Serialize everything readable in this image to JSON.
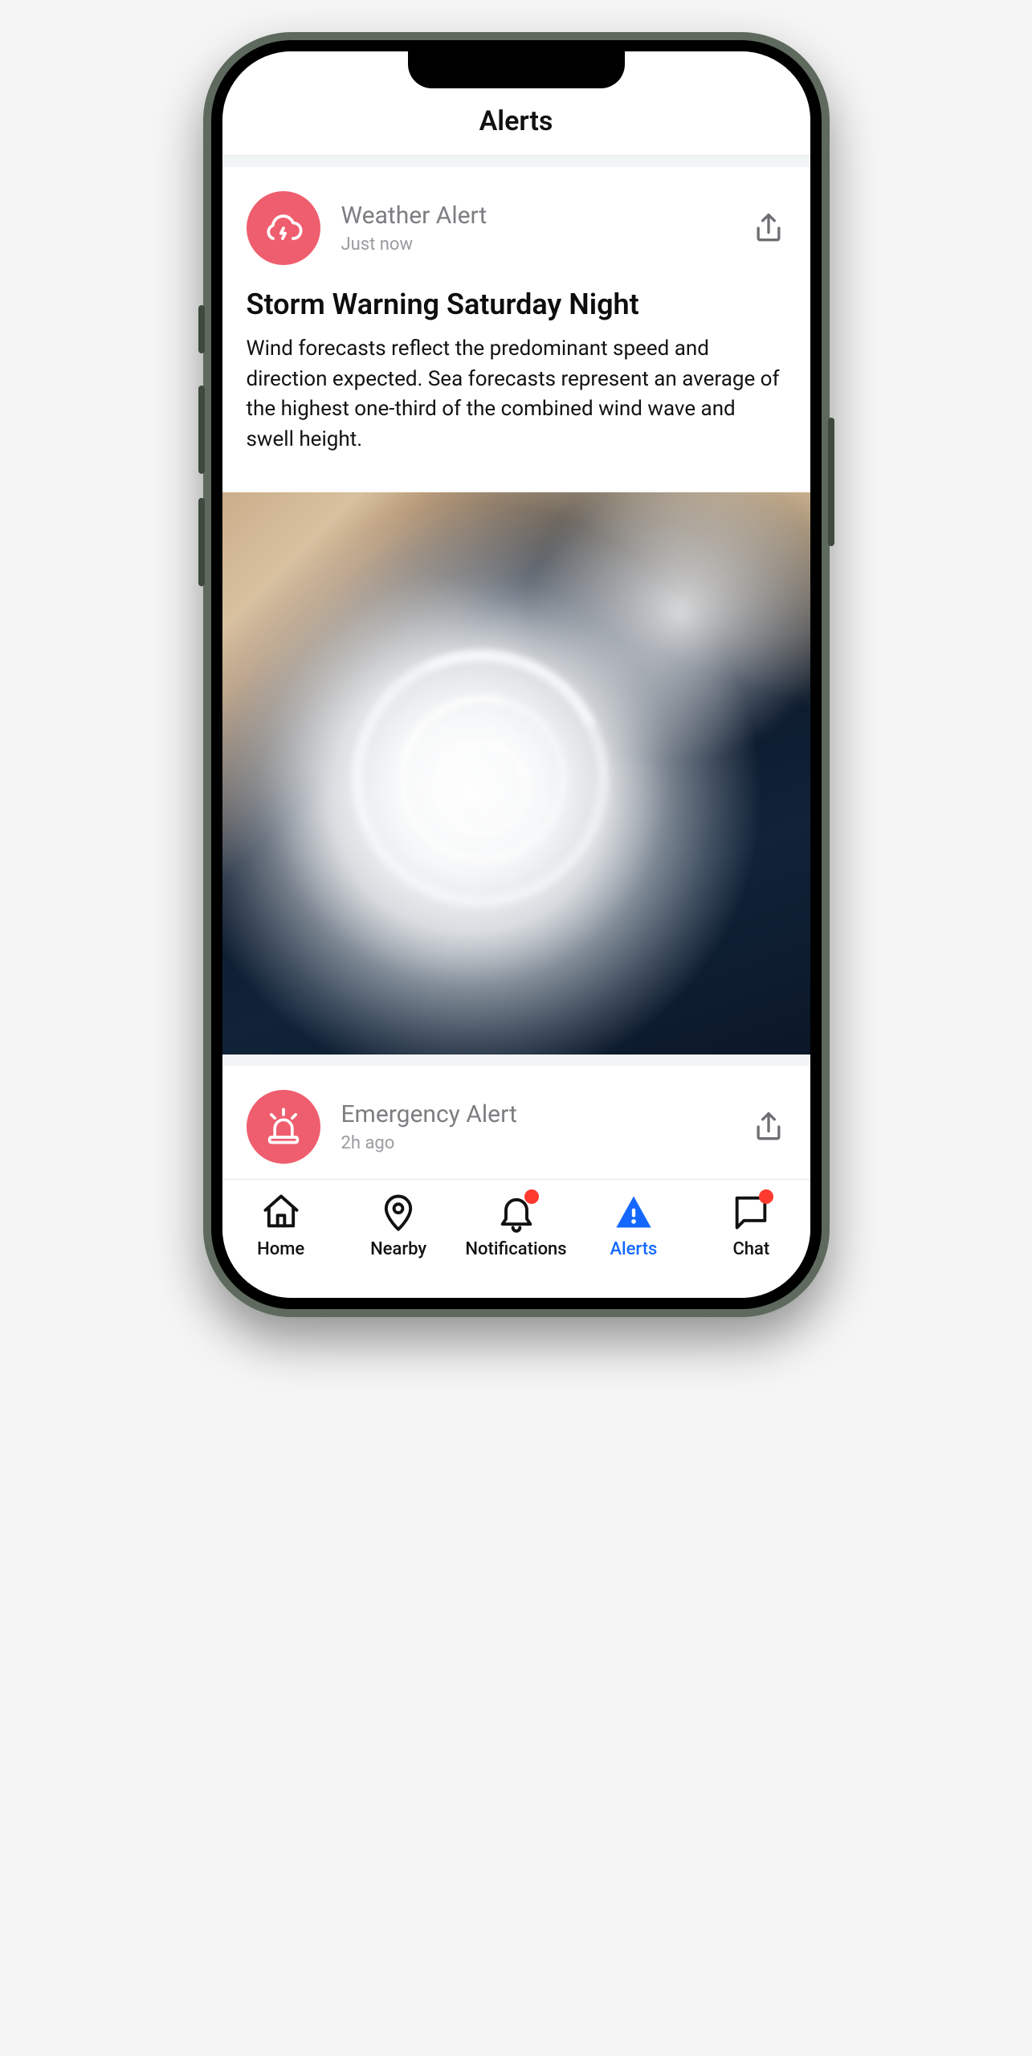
{
  "header": {
    "title": "Alerts"
  },
  "cards": [
    {
      "icon": "cloud-storm-icon",
      "source": "Weather Alert",
      "time": "Just now",
      "title": "Storm Warning Saturday Night",
      "body": "Wind forecasts reflect the predominant speed and direction expected. Sea forecasts represent an average of the highest one-third of the combined wind wave and swell height.",
      "image": "hurricane-satellite"
    },
    {
      "icon": "siren-icon",
      "source": "Emergency Alert",
      "time": "2h ago"
    }
  ],
  "tabs": [
    {
      "label": "Home",
      "icon": "home-icon",
      "active": false,
      "badge": false
    },
    {
      "label": "Nearby",
      "icon": "pin-icon",
      "active": false,
      "badge": false
    },
    {
      "label": "Notifications",
      "icon": "bell-icon",
      "active": false,
      "badge": true
    },
    {
      "label": "Alerts",
      "icon": "warning-icon",
      "active": true,
      "badge": false
    },
    {
      "label": "Chat",
      "icon": "chat-icon",
      "active": false,
      "badge": true
    }
  ],
  "colors": {
    "accent": "#1468ff",
    "badge_bg": "#ef5e6e",
    "dot": "#ff3b30"
  }
}
